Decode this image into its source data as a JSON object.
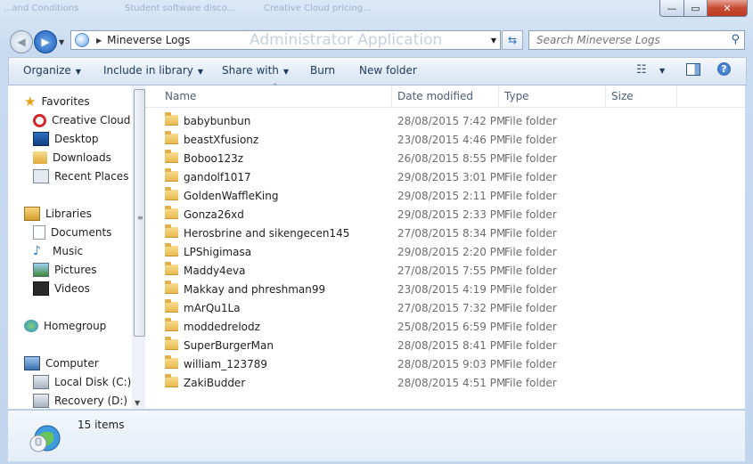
{
  "background_tabs": [
    "...and Conditions",
    "Student software disco...",
    "Creative Cloud pricing..."
  ],
  "window_controls": {
    "minimize": "—",
    "maximize": "▭",
    "close": "✕"
  },
  "address_bar": {
    "path": "Mineverse Logs",
    "ghost_text": "Administrator Application"
  },
  "search": {
    "placeholder": "Search Mineverse Logs"
  },
  "toolbar": {
    "organize": "Organize",
    "include_in_library": "Include in library",
    "share_with": "Share with",
    "burn": "Burn",
    "new_folder": "New folder"
  },
  "nav_pane": {
    "favorites": {
      "label": "Favorites",
      "items": [
        "Creative Cloud Fi",
        "Desktop",
        "Downloads",
        "Recent Places"
      ]
    },
    "libraries": {
      "label": "Libraries",
      "items": [
        "Documents",
        "Music",
        "Pictures",
        "Videos"
      ]
    },
    "homegroup": "Homegroup",
    "computer": {
      "label": "Computer",
      "items": [
        "Local Disk (C:)",
        "Recovery (D:)"
      ]
    }
  },
  "columns": {
    "name": "Name",
    "date_modified": "Date modified",
    "type": "Type",
    "size": "Size"
  },
  "files": [
    {
      "name": "babybunbun",
      "date": "28/08/2015 7:42 PM",
      "type": "File folder"
    },
    {
      "name": "beastXfusionz",
      "date": "23/08/2015 4:46 PM",
      "type": "File folder"
    },
    {
      "name": "Boboo123z",
      "date": "26/08/2015 8:55 PM",
      "type": "File folder"
    },
    {
      "name": "gandolf1017",
      "date": "29/08/2015 3:01 PM",
      "type": "File folder"
    },
    {
      "name": "GoldenWaffleKing",
      "date": "29/08/2015 2:11 PM",
      "type": "File folder"
    },
    {
      "name": "Gonza26xd",
      "date": "29/08/2015 2:33 PM",
      "type": "File folder"
    },
    {
      "name": "Herosbrine and sikengecen145",
      "date": "27/08/2015 8:34 PM",
      "type": "File folder"
    },
    {
      "name": "LPShigimasa",
      "date": "29/08/2015 2:20 PM",
      "type": "File folder"
    },
    {
      "name": "Maddy4eva",
      "date": "27/08/2015 7:55 PM",
      "type": "File folder"
    },
    {
      "name": "Makkay and phreshman99",
      "date": "23/08/2015 4:19 PM",
      "type": "File folder"
    },
    {
      "name": "mArQu1La",
      "date": "27/08/2015 7:32 PM",
      "type": "File folder"
    },
    {
      "name": "moddedrelodz",
      "date": "25/08/2015 6:59 PM",
      "type": "File folder"
    },
    {
      "name": "SuperBurgerMan",
      "date": "28/08/2015 8:41 PM",
      "type": "File folder"
    },
    {
      "name": "william_123789",
      "date": "28/08/2015 9:03 PM",
      "type": "File folder"
    },
    {
      "name": "ZakiBudder",
      "date": "28/08/2015 4:51 PM",
      "type": "File folder"
    }
  ],
  "status": {
    "item_count": "15 items"
  },
  "icons": {
    "back": "back-arrow-icon",
    "forward": "forward-arrow-icon",
    "search": "search-icon",
    "refresh": "refresh-icon",
    "folder": "folder-icon",
    "help": "help-icon"
  },
  "colors": {
    "accent": "#1c5fb8",
    "folder": "#e8b74b",
    "toolbar_text": "#1e395b"
  }
}
